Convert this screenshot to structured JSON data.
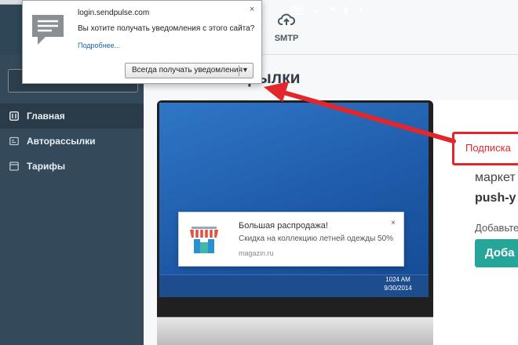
{
  "popup": {
    "site": "login.sendpulse.com",
    "question": "Вы хотите получать уведомления с этого сайта?",
    "more_link": "Подробнее...",
    "button_label": "Всегда получать уведомления",
    "close_glyph": "×",
    "icon": "chat-bubble-icon"
  },
  "header": {
    "smtp_label": "SMTP",
    "smtp_icon": "cloud-upload-icon"
  },
  "sidebar": {
    "items": [
      {
        "label": "Главная",
        "icon": "dashboard-icon",
        "active": true
      },
      {
        "label": "Авторассылки",
        "icon": "autoresponder-icon",
        "active": false
      },
      {
        "label": "Тарифы",
        "icon": "pricing-icon",
        "active": false
      }
    ]
  },
  "main": {
    "title_fragment": "рылки"
  },
  "laptop_demo": {
    "toast_title": "Большая распродажа!",
    "toast_body": "Скидка на коллекцию летней одежды 50%",
    "toast_site": "magazin.ru",
    "toast_close": "×",
    "tray_time": "1024 AM",
    "tray_date": "9/30/2014"
  },
  "promo": {
    "callout": "Подписка",
    "line1": "маркет",
    "line2": "push-у",
    "line3": "Добавьте",
    "button": "Доба"
  },
  "colors": {
    "sidebar": "#34495a",
    "accent_red": "#e3262c",
    "accent_teal": "#26a69a"
  }
}
